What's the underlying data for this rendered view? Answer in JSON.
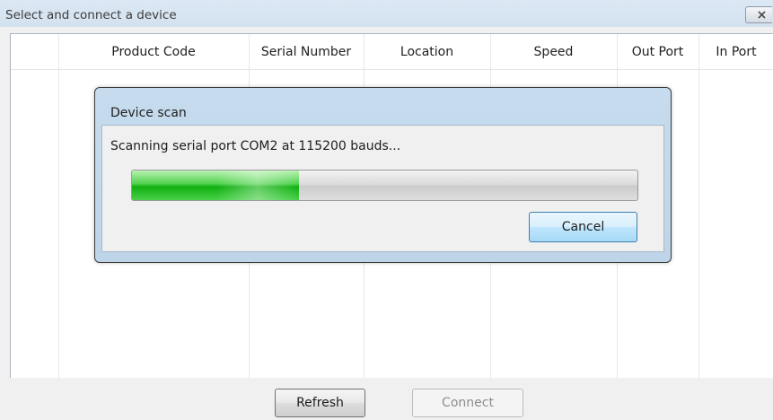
{
  "window": {
    "title": "Select and connect a device"
  },
  "table": {
    "columns": [
      {
        "label": "Product Code"
      },
      {
        "label": "Serial Number"
      },
      {
        "label": "Location"
      },
      {
        "label": "Speed"
      },
      {
        "label": "Out Port"
      },
      {
        "label": "In Port"
      }
    ]
  },
  "dialog": {
    "title": "Device scan",
    "status": "Scanning serial port COM2 at 115200 bauds...",
    "progress_fraction": 0.33,
    "cancel_label": "Cancel"
  },
  "buttons": {
    "refresh_label": "Refresh",
    "connect_label": "Connect"
  },
  "icons": {
    "close": "close-icon"
  }
}
